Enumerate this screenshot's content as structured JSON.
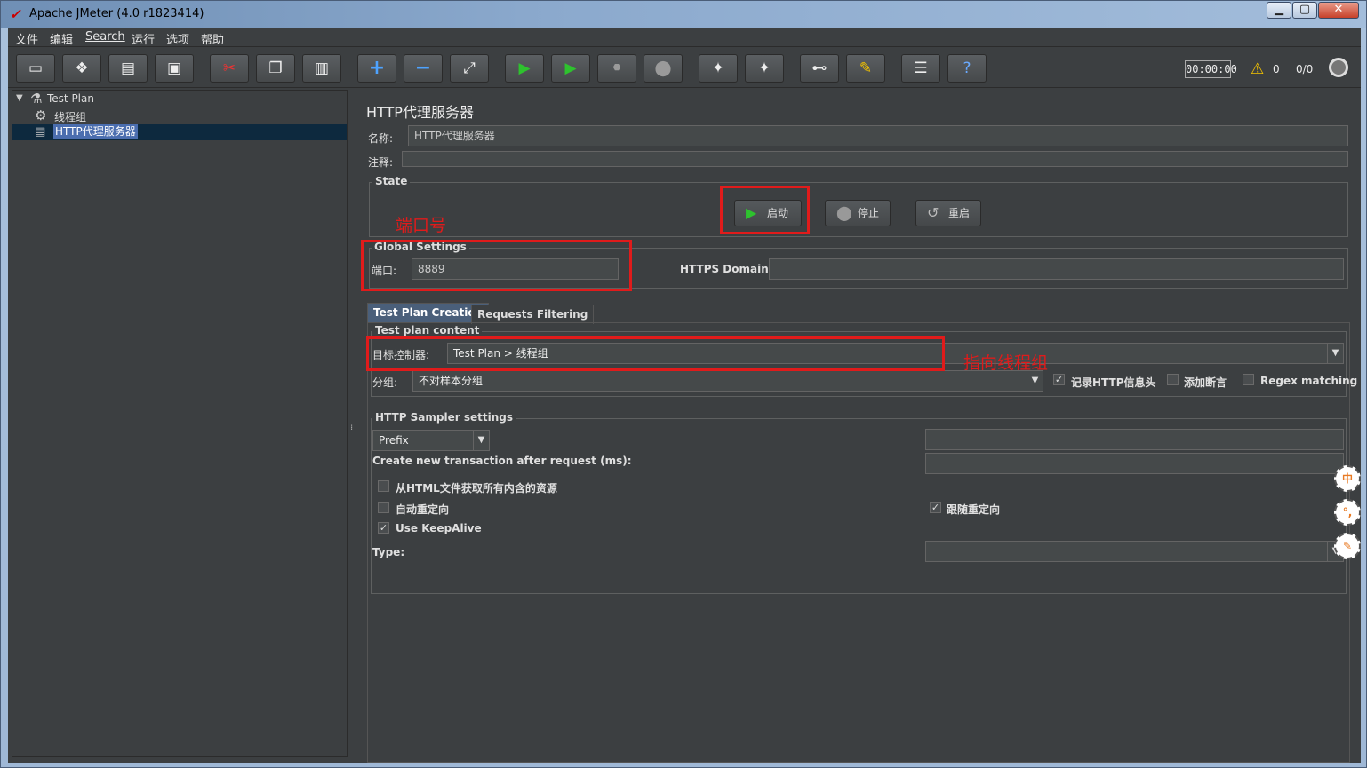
{
  "window": {
    "title": "Apache JMeter (4.0 r1823414)",
    "controls": [
      "▁",
      "▢",
      "✕"
    ]
  },
  "menu": [
    "文件",
    "编辑",
    "Search",
    "运行",
    "选项",
    "帮助"
  ],
  "toolbar": {
    "timer": "00:00:00",
    "warnings": "0",
    "threads": "0/0"
  },
  "tree": {
    "items": [
      {
        "label": "Test Plan",
        "icon": "test-plan-icon"
      },
      {
        "label": "线程组",
        "icon": "gear-icon"
      },
      {
        "label": "HTTP代理服务器",
        "icon": "proxy-icon"
      }
    ]
  },
  "panel": {
    "title": "HTTP代理服务器",
    "name_label": "名称:",
    "name_value": "HTTP代理服务器",
    "comment_label": "注释:",
    "state": {
      "legend": "State",
      "start": "启动",
      "stop": "停止",
      "restart": "重启"
    },
    "global": {
      "legend": "Global Settings",
      "port_label": "端口:",
      "port_value": "8889",
      "https_label": "HTTPS Domains:"
    },
    "tabs": [
      "Test Plan Creation",
      "Requests Filtering"
    ],
    "content": {
      "legend": "Test plan content",
      "target_label": "目标控制器:",
      "target_value": "Test Plan > 线程组",
      "group_label": "分组:",
      "group_value": "不对样本分组",
      "record_headers": "记录HTTP信息头",
      "add_assertions": "添加断言",
      "regex_matching": "Regex matching"
    },
    "sampler": {
      "legend": "HTTP Sampler settings",
      "prefix_value": "Prefix",
      "new_txn_label": "Create new transaction after request (ms):",
      "fetch_resources": "从HTML文件获取所有内含的资源",
      "auto_redirect": "自动重定向",
      "follow_redirect": "跟随重定向",
      "keepalive": "Use KeepAlive",
      "type_label": "Type:"
    }
  },
  "annotations": {
    "port_note": "端口号",
    "target_note": "指向线程组"
  },
  "side_badges": [
    "中",
    "°,",
    "✎"
  ]
}
